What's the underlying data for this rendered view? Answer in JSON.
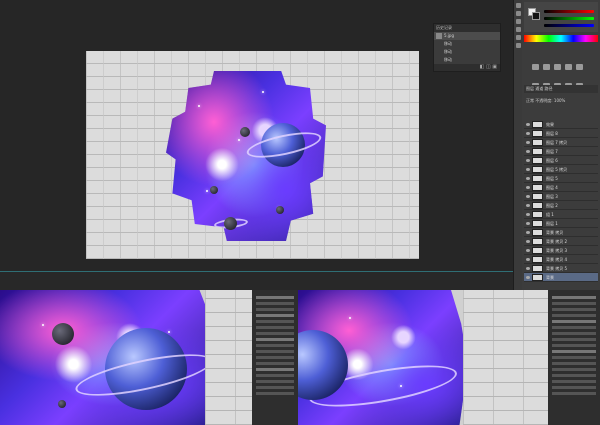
{
  "history_panel": {
    "title": "历史记录",
    "file_name": "5.jpg",
    "items": [
      "移动",
      "移动",
      "移动"
    ]
  },
  "layers_panel": {
    "tabs_label": "图层  通道  路径",
    "mode_label": "正常",
    "opacity_label": "不透明度: 100%",
    "layers": [
      "效果",
      "图层 8",
      "图层 7 拷贝",
      "图层 7",
      "图层 6",
      "图层 5 拷贝",
      "图层 5",
      "图层 4",
      "图层 3",
      "图层 2",
      "组 1",
      "图层 1",
      "背景 拷贝",
      "背景 拷贝 2",
      "背景 拷贝 3",
      "背景 拷贝 4",
      "背景 拷贝 5",
      "背景"
    ]
  },
  "colors": {
    "canvas_bg": "#262626",
    "panel_bg": "#3c3c3c",
    "accent_line": "#2f6e75",
    "selected_layer": "#5a6a86"
  },
  "icons": [
    "foreground-background-swatch-icon",
    "color-spectrum-icon",
    "eye-icon",
    "adjustment-icons"
  ]
}
